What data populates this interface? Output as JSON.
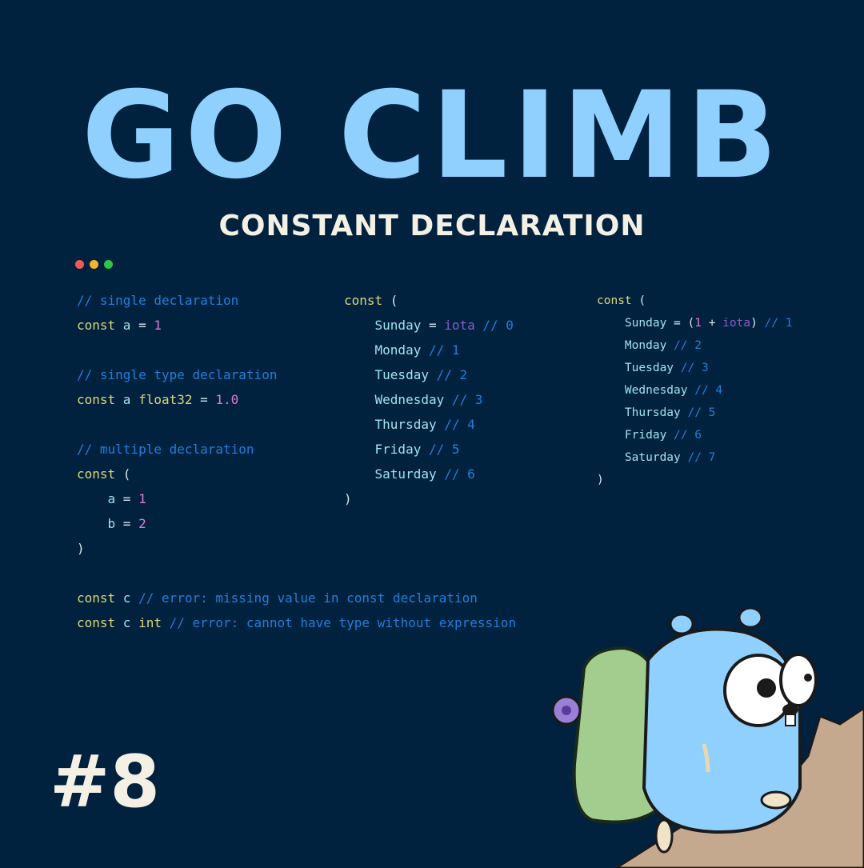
{
  "header": {
    "title": "GO CLIMB",
    "subtitle": "CONSTANT DECLARATION"
  },
  "badge": "#8",
  "colors": {
    "background": "#00223f",
    "title": "#8fd0ff",
    "keyword": "#dcd67a",
    "ident": "#9fe3ec",
    "comment": "#1f7fdb",
    "number": "#e07ad6",
    "builtin": "#8a5cc7",
    "plain": "#d8e6ee"
  },
  "window_dots": [
    "#f25a55",
    "#f4b22a",
    "#2ec444"
  ],
  "code_blocks": [
    {
      "lines": [
        [
          [
            "comment",
            "// single declaration"
          ]
        ],
        [
          [
            "keyword",
            "const "
          ],
          [
            "ident",
            "a"
          ],
          [
            "plain",
            " = "
          ],
          [
            "number",
            "1"
          ]
        ],
        [],
        [
          [
            "comment",
            "// single type declaration"
          ]
        ],
        [
          [
            "keyword",
            "const "
          ],
          [
            "ident",
            "a "
          ],
          [
            "keyword",
            "float32"
          ],
          [
            "plain",
            " = "
          ],
          [
            "number",
            "1.0"
          ]
        ],
        [],
        [
          [
            "comment",
            "// multiple declaration"
          ]
        ],
        [
          [
            "keyword",
            "const "
          ],
          [
            "plain",
            "("
          ]
        ],
        [
          [
            "ident",
            "    a"
          ],
          [
            "plain",
            " = "
          ],
          [
            "number",
            "1"
          ]
        ],
        [
          [
            "ident",
            "    b"
          ],
          [
            "plain",
            " = "
          ],
          [
            "number",
            "2"
          ]
        ],
        [
          [
            "plain",
            ")"
          ]
        ],
        [],
        [
          [
            "keyword",
            "const "
          ],
          [
            "ident",
            "c "
          ],
          [
            "comment",
            "// error: missing value in const declaration"
          ]
        ],
        [
          [
            "keyword",
            "const "
          ],
          [
            "ident",
            "c "
          ],
          [
            "keyword",
            "int "
          ],
          [
            "comment",
            "// error: cannot have type without expression"
          ]
        ]
      ]
    },
    {
      "lines": [
        [
          [
            "keyword",
            "const "
          ],
          [
            "plain",
            "("
          ]
        ],
        [
          [
            "ident",
            "    Sunday"
          ],
          [
            "plain",
            " = "
          ],
          [
            "builtin",
            "iota"
          ],
          [
            "comment",
            " // 0"
          ]
        ],
        [
          [
            "ident",
            "    Monday"
          ],
          [
            "comment",
            " // 1"
          ]
        ],
        [
          [
            "ident",
            "    Tuesday"
          ],
          [
            "comment",
            " // 2"
          ]
        ],
        [
          [
            "ident",
            "    Wednesday"
          ],
          [
            "comment",
            " // 3"
          ]
        ],
        [
          [
            "ident",
            "    Thursday"
          ],
          [
            "comment",
            " // 4"
          ]
        ],
        [
          [
            "ident",
            "    Friday"
          ],
          [
            "comment",
            " // 5"
          ]
        ],
        [
          [
            "ident",
            "    Saturday"
          ],
          [
            "comment",
            " // 6"
          ]
        ],
        [
          [
            "plain",
            ")"
          ]
        ]
      ]
    },
    {
      "lines": [
        [
          [
            "keyword",
            "const "
          ],
          [
            "plain",
            "("
          ]
        ],
        [
          [
            "ident",
            "    Sunday"
          ],
          [
            "plain",
            " = ("
          ],
          [
            "number",
            "1"
          ],
          [
            "plain",
            " + "
          ],
          [
            "builtin",
            "iota"
          ],
          [
            "plain",
            ")"
          ],
          [
            "comment",
            " // 1"
          ]
        ],
        [
          [
            "ident",
            "    Monday"
          ],
          [
            "comment",
            " // 2"
          ]
        ],
        [
          [
            "ident",
            "    Tuesday"
          ],
          [
            "comment",
            " // 3"
          ]
        ],
        [
          [
            "ident",
            "    Wednesday"
          ],
          [
            "comment",
            " // 4"
          ]
        ],
        [
          [
            "ident",
            "    Thursday"
          ],
          [
            "comment",
            " // 5"
          ]
        ],
        [
          [
            "ident",
            "    Friday"
          ],
          [
            "comment",
            " // 6"
          ]
        ],
        [
          [
            "ident",
            "    Saturday"
          ],
          [
            "comment",
            " // 7"
          ]
        ],
        [
          [
            "plain",
            ")"
          ]
        ]
      ]
    }
  ],
  "illustration": {
    "icon": "gopher-climbing-icon"
  }
}
